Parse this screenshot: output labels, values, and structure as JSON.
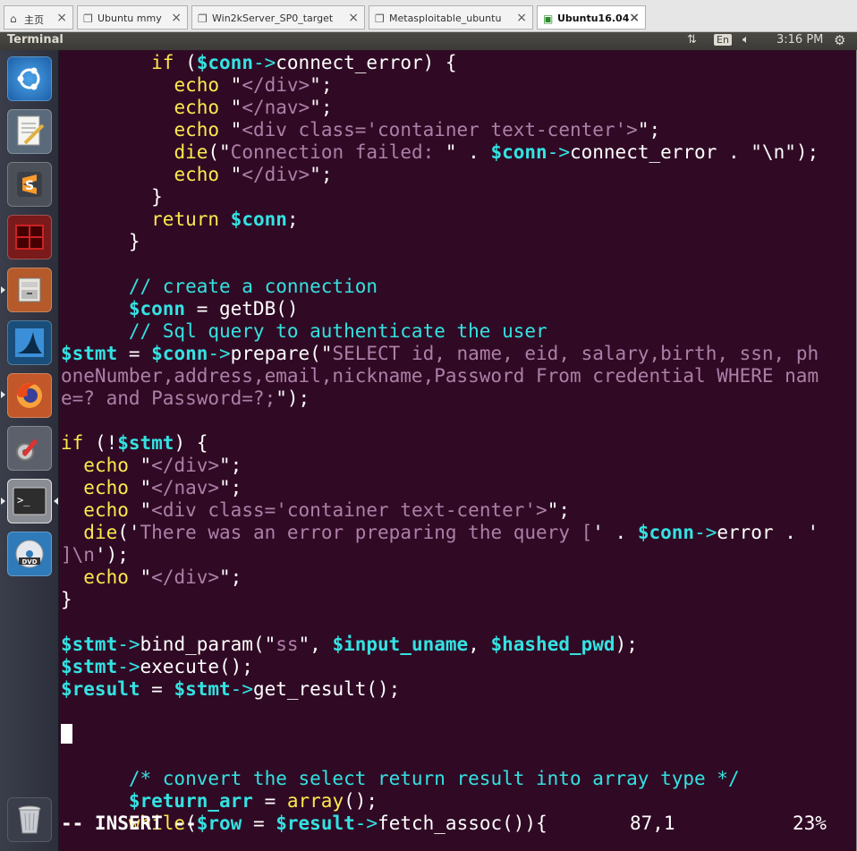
{
  "vm_tabs": [
    {
      "label": "主页",
      "icon": "home-icon"
    },
    {
      "label": "Ubuntu mmy",
      "icon": "vm-icon"
    },
    {
      "label": "Win2kServer_SP0_target",
      "icon": "vm-icon"
    },
    {
      "label": "Metasploitable_ubuntu",
      "icon": "vm-icon"
    },
    {
      "label": "Ubuntu16.04",
      "icon": "vm-running-icon",
      "active": true
    }
  ],
  "panel": {
    "app_title": "Terminal",
    "keyboard": "En",
    "time": "3:16 PM"
  },
  "launcher": [
    "ubuntu-dash-icon",
    "text-editor-icon",
    "sublime-text-icon",
    "terminator-icon",
    "file-manager-icon",
    "wireshark-icon",
    "firefox-icon",
    "system-settings-icon",
    "terminal-icon",
    "dvd-icon",
    "trash-icon"
  ],
  "editor": {
    "mode": "-- INSERT --",
    "position": "87,1",
    "percent": "23%",
    "lines": [
      [
        [
          "p",
          "        "
        ],
        [
          "kw",
          "if"
        ],
        [
          "p",
          " ("
        ],
        [
          "var",
          "$conn"
        ],
        [
          "arrow",
          "->"
        ],
        [
          "p",
          "connect_error) {"
        ]
      ],
      [
        [
          "p",
          "          "
        ],
        [
          "kw",
          "echo"
        ],
        [
          "p",
          " \""
        ],
        [
          "str",
          "</div>"
        ],
        [
          "p",
          "\";"
        ]
      ],
      [
        [
          "p",
          "          "
        ],
        [
          "kw",
          "echo"
        ],
        [
          "p",
          " \""
        ],
        [
          "str",
          "</nav>"
        ],
        [
          "p",
          "\";"
        ]
      ],
      [
        [
          "p",
          "          "
        ],
        [
          "kw",
          "echo"
        ],
        [
          "p",
          " \""
        ],
        [
          "str",
          "<div class='container text-center'>"
        ],
        [
          "p",
          "\";"
        ]
      ],
      [
        [
          "p",
          "          "
        ],
        [
          "kw",
          "die"
        ],
        [
          "p",
          "(\""
        ],
        [
          "str",
          "Connection failed: "
        ],
        [
          "p",
          "\" . "
        ],
        [
          "var",
          "$conn"
        ],
        [
          "arrow",
          "->"
        ],
        [
          "p",
          "connect_error . \""
        ],
        [
          "p",
          "\\n"
        ],
        [
          "p",
          "\");"
        ]
      ],
      [
        [
          "p",
          "          "
        ],
        [
          "kw",
          "echo"
        ],
        [
          "p",
          " \""
        ],
        [
          "str",
          "</div>"
        ],
        [
          "p",
          "\";"
        ]
      ],
      [
        [
          "p",
          "        }"
        ]
      ],
      [
        [
          "p",
          "        "
        ],
        [
          "kw",
          "return"
        ],
        [
          "p",
          " "
        ],
        [
          "var",
          "$conn"
        ],
        [
          "p",
          ";"
        ]
      ],
      [
        [
          "p",
          "      }"
        ]
      ],
      [
        [
          "p",
          ""
        ]
      ],
      [
        [
          "p",
          "      "
        ],
        [
          "cmt",
          "// create a connection"
        ]
      ],
      [
        [
          "p",
          "      "
        ],
        [
          "var",
          "$conn"
        ],
        [
          "p",
          " = getDB()"
        ]
      ],
      [
        [
          "p",
          "      "
        ],
        [
          "cmt",
          "// Sql query to authenticate the user"
        ]
      ],
      [
        [
          "var",
          "$stmt"
        ],
        [
          "p",
          " = "
        ],
        [
          "var",
          "$conn"
        ],
        [
          "arrow",
          "->"
        ],
        [
          "p",
          "prepare(\""
        ],
        [
          "str",
          "SELECT id, name, eid, salary,birth, ssn, ph"
        ]
      ],
      [
        [
          "str",
          "oneNumber,address,email,nickname,Password From credential WHERE nam"
        ]
      ],
      [
        [
          "str",
          "e=? and Password=?;"
        ],
        [
          "p",
          "\");"
        ]
      ],
      [
        [
          "p",
          ""
        ]
      ],
      [
        [
          "kw",
          "if"
        ],
        [
          "p",
          " (!"
        ],
        [
          "var",
          "$stmt"
        ],
        [
          "p",
          ") {"
        ]
      ],
      [
        [
          "p",
          "  "
        ],
        [
          "kw",
          "echo"
        ],
        [
          "p",
          " \""
        ],
        [
          "str",
          "</div>"
        ],
        [
          "p",
          "\";"
        ]
      ],
      [
        [
          "p",
          "  "
        ],
        [
          "kw",
          "echo"
        ],
        [
          "p",
          " \""
        ],
        [
          "str",
          "</nav>"
        ],
        [
          "p",
          "\";"
        ]
      ],
      [
        [
          "p",
          "  "
        ],
        [
          "kw",
          "echo"
        ],
        [
          "p",
          " \""
        ],
        [
          "str",
          "<div class='container text-center'>"
        ],
        [
          "p",
          "\";"
        ]
      ],
      [
        [
          "p",
          "  "
        ],
        [
          "kw",
          "die"
        ],
        [
          "p",
          "('"
        ],
        [
          "str",
          "There was an error preparing the query ["
        ],
        [
          "p",
          "' . "
        ],
        [
          "var",
          "$conn"
        ],
        [
          "arrow",
          "->"
        ],
        [
          "p",
          "error . '"
        ]
      ],
      [
        [
          "str",
          "]\\n"
        ],
        [
          "p",
          "');"
        ]
      ],
      [
        [
          "p",
          "  "
        ],
        [
          "kw",
          "echo"
        ],
        [
          "p",
          " \""
        ],
        [
          "str",
          "</div>"
        ],
        [
          "p",
          "\";"
        ]
      ],
      [
        [
          "p",
          "}"
        ]
      ],
      [
        [
          "p",
          ""
        ]
      ],
      [
        [
          "var",
          "$stmt"
        ],
        [
          "arrow",
          "->"
        ],
        [
          "p",
          "bind_param(\""
        ],
        [
          "str",
          "ss"
        ],
        [
          "p",
          "\", "
        ],
        [
          "var",
          "$input_uname"
        ],
        [
          "p",
          ", "
        ],
        [
          "var",
          "$hashed_pwd"
        ],
        [
          "p",
          ");"
        ]
      ],
      [
        [
          "var",
          "$stmt"
        ],
        [
          "arrow",
          "->"
        ],
        [
          "p",
          "execute();"
        ]
      ],
      [
        [
          "var",
          "$result"
        ],
        [
          "p",
          " = "
        ],
        [
          "var",
          "$stmt"
        ],
        [
          "arrow",
          "->"
        ],
        [
          "p",
          "get_result();"
        ]
      ],
      [
        [
          "p",
          ""
        ]
      ],
      [
        [
          "cursor",
          ""
        ]
      ],
      [
        [
          "p",
          ""
        ]
      ],
      [
        [
          "p",
          "      "
        ],
        [
          "cmt",
          "/* convert the select return result into array type */"
        ]
      ],
      [
        [
          "p",
          "      "
        ],
        [
          "var",
          "$return_arr"
        ],
        [
          "p",
          " = "
        ],
        [
          "kw",
          "array"
        ],
        [
          "p",
          "();"
        ]
      ],
      [
        [
          "p",
          "      "
        ],
        [
          "kw",
          "while"
        ],
        [
          "p",
          "("
        ],
        [
          "var",
          "$row"
        ],
        [
          "p",
          " = "
        ],
        [
          "var",
          "$result"
        ],
        [
          "arrow",
          "->"
        ],
        [
          "p",
          "fetch_assoc()){"
        ]
      ]
    ]
  }
}
